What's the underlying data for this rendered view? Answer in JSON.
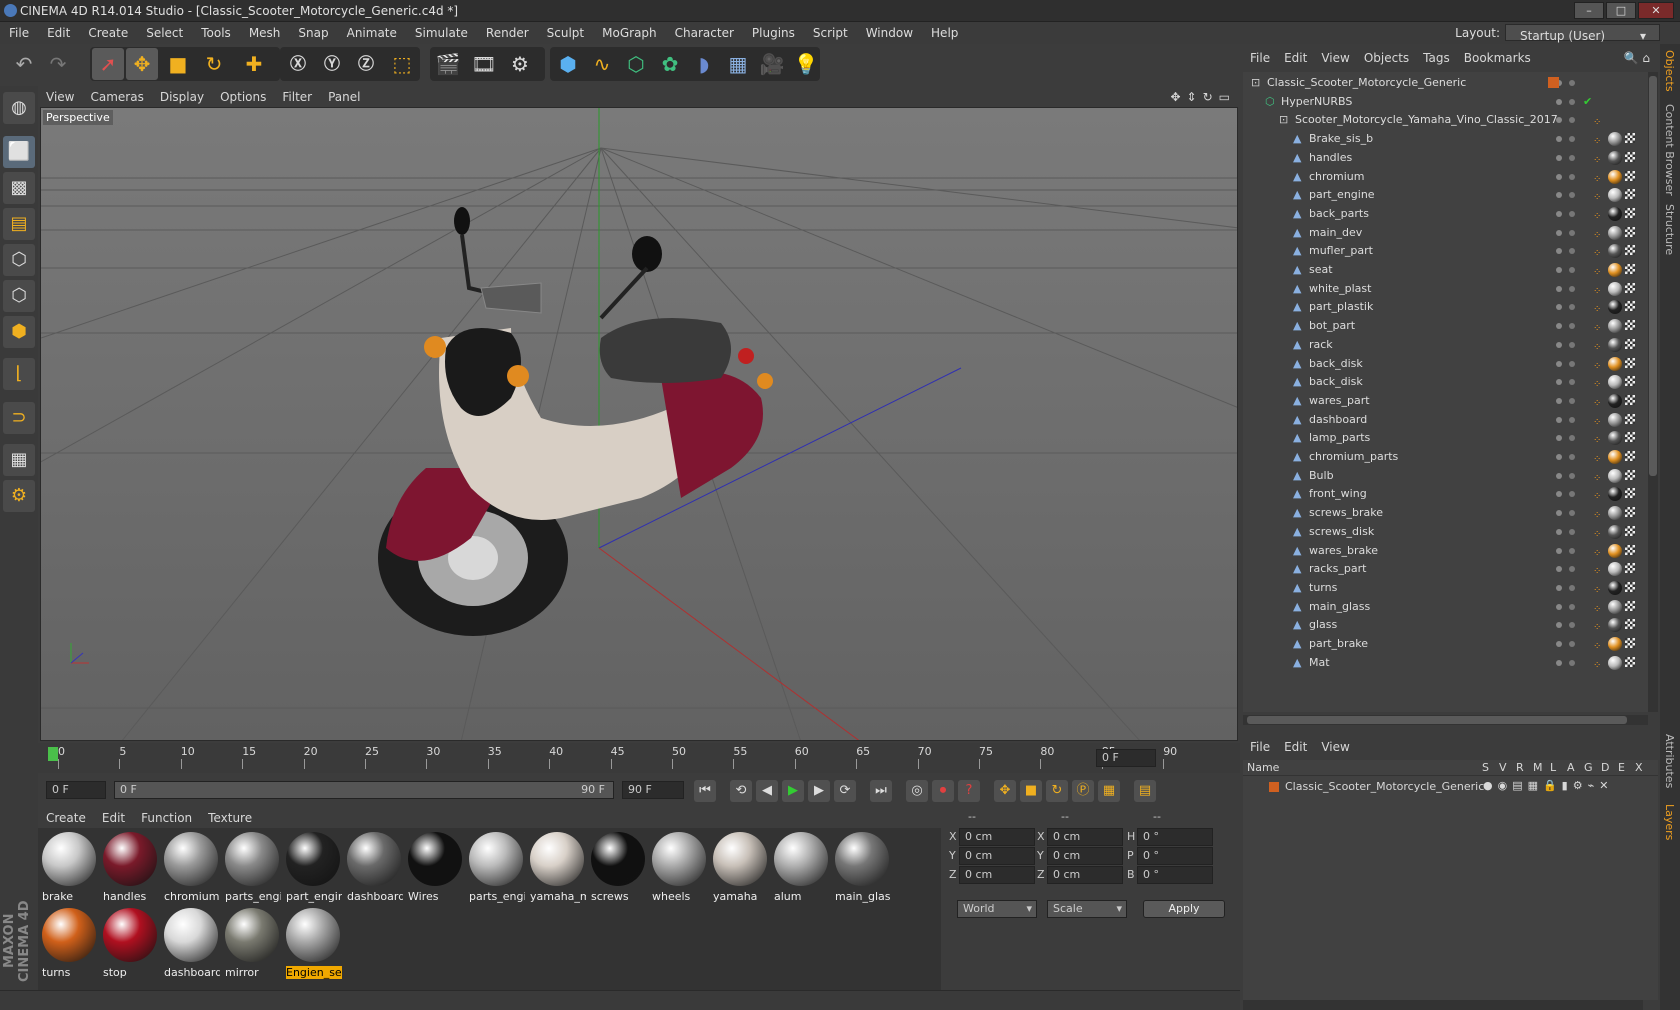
{
  "window": {
    "title": "CINEMA 4D R14.014 Studio - [Classic_Scooter_Motorcycle_Generic.c4d *]"
  },
  "menu": [
    "File",
    "Edit",
    "Create",
    "Select",
    "Tools",
    "Mesh",
    "Snap",
    "Animate",
    "Simulate",
    "Render",
    "Sculpt",
    "MoGraph",
    "Character",
    "Plugins",
    "Script",
    "Window",
    "Help"
  ],
  "layout": {
    "label": "Layout:",
    "value": "Startup (User)"
  },
  "viewport": {
    "menu": [
      "View",
      "Cameras",
      "Display",
      "Options",
      "Filter",
      "Panel"
    ],
    "label": "Perspective"
  },
  "timeline": {
    "ticks": [
      "0",
      "5",
      "10",
      "15",
      "20",
      "25",
      "30",
      "35",
      "40",
      "45",
      "50",
      "55",
      "60",
      "65",
      "70",
      "75",
      "80",
      "85",
      "90"
    ],
    "current_frame": "0 F",
    "start": "0 F",
    "range_start": "0 F",
    "range_end": "90 F",
    "end": "90 F"
  },
  "materials_menu": [
    "Create",
    "Edit",
    "Function",
    "Texture"
  ],
  "materials": [
    {
      "name": "brake",
      "color": "#c8c8c8"
    },
    {
      "name": "handles",
      "color": "#7a1a2a"
    },
    {
      "name": "chromium",
      "color": "#9a9a9a"
    },
    {
      "name": "parts_engi",
      "color": "#8a8a8a"
    },
    {
      "name": "part_engin",
      "color": "#222222"
    },
    {
      "name": "dashboard",
      "color": "#6a6a6a"
    },
    {
      "name": "Wires",
      "color": "#111111"
    },
    {
      "name": "parts_engi",
      "color": "#bbbbbb"
    },
    {
      "name": "yamaha_ma",
      "color": "#d8d0c8"
    },
    {
      "name": "screws",
      "color": "#101010"
    },
    {
      "name": "wheels",
      "color": "#aaaaaa"
    },
    {
      "name": "yamaha",
      "color": "#c8c0b8"
    },
    {
      "name": "alum",
      "color": "#b0b0b0"
    },
    {
      "name": "main_glass",
      "color": "#777777"
    },
    {
      "name": "turns",
      "color": "#d0601a"
    },
    {
      "name": "stop",
      "color": "#b01020"
    },
    {
      "name": "dashboard",
      "color": "#d8d8d8"
    },
    {
      "name": "mirror",
      "color": "#7a7a70"
    },
    {
      "name": "Engien_se",
      "color": "#a8a8a8",
      "selected": true
    }
  ],
  "coords": {
    "headers": [
      "--",
      "--",
      "--"
    ],
    "rows": [
      {
        "a": "X",
        "av": "0 cm",
        "b": "X",
        "bv": "0 cm",
        "c": "H",
        "cv": "0 °"
      },
      {
        "a": "Y",
        "av": "0 cm",
        "b": "Y",
        "bv": "0 cm",
        "c": "P",
        "cv": "0 °"
      },
      {
        "a": "Z",
        "av": "0 cm",
        "b": "Z",
        "bv": "0 cm",
        "c": "B",
        "cv": "0 °"
      }
    ],
    "mode1": "World",
    "mode2": "Scale",
    "apply": "Apply"
  },
  "objects_menu": [
    "File",
    "Edit",
    "View",
    "Objects",
    "Tags",
    "Bookmarks"
  ],
  "objects": [
    {
      "name": "Classic_Scooter_Motorcycle_Generic",
      "indent": 0
    },
    {
      "name": "HyperNURBS",
      "indent": 1
    },
    {
      "name": "Scooter_Motorcycle_Yamaha_Vino_Classic_2017",
      "indent": 2
    },
    {
      "name": "Brake_sis_b",
      "indent": 3
    },
    {
      "name": "handles",
      "indent": 3
    },
    {
      "name": "chromium",
      "indent": 3
    },
    {
      "name": "part_engine",
      "indent": 3
    },
    {
      "name": "back_parts",
      "indent": 3
    },
    {
      "name": "main_dev",
      "indent": 3
    },
    {
      "name": "mufler_part",
      "indent": 3
    },
    {
      "name": "seat",
      "indent": 3
    },
    {
      "name": "white_plast",
      "indent": 3
    },
    {
      "name": "part_plastik",
      "indent": 3
    },
    {
      "name": "bot_part",
      "indent": 3
    },
    {
      "name": "rack",
      "indent": 3
    },
    {
      "name": "back_disk",
      "indent": 3
    },
    {
      "name": "back_disk",
      "indent": 3
    },
    {
      "name": "wares_part",
      "indent": 3
    },
    {
      "name": "dashboard",
      "indent": 3
    },
    {
      "name": "lamp_parts",
      "indent": 3
    },
    {
      "name": "chromium_parts",
      "indent": 3
    },
    {
      "name": "Bulb",
      "indent": 3
    },
    {
      "name": "front_wing",
      "indent": 3
    },
    {
      "name": "screws_brake",
      "indent": 3
    },
    {
      "name": "screws_disk",
      "indent": 3
    },
    {
      "name": "wares_brake",
      "indent": 3
    },
    {
      "name": "racks_part",
      "indent": 3
    },
    {
      "name": "turns",
      "indent": 3
    },
    {
      "name": "main_glass",
      "indent": 3
    },
    {
      "name": "glass",
      "indent": 3
    },
    {
      "name": "part_brake",
      "indent": 3
    },
    {
      "name": "Mat",
      "indent": 3
    }
  ],
  "layers_menu": [
    "File",
    "Edit",
    "View"
  ],
  "layers": {
    "columns": [
      "Name",
      "S",
      "V",
      "R",
      "M",
      "L",
      "A",
      "G",
      "D",
      "E",
      "X"
    ],
    "row": "Classic_Scooter_Motorcycle_Generic"
  },
  "side_tabs": [
    "Objects",
    "Content Browser",
    "Structure",
    "Attributes",
    "Layers"
  ],
  "brand": "MAXON CINEMA 4D"
}
